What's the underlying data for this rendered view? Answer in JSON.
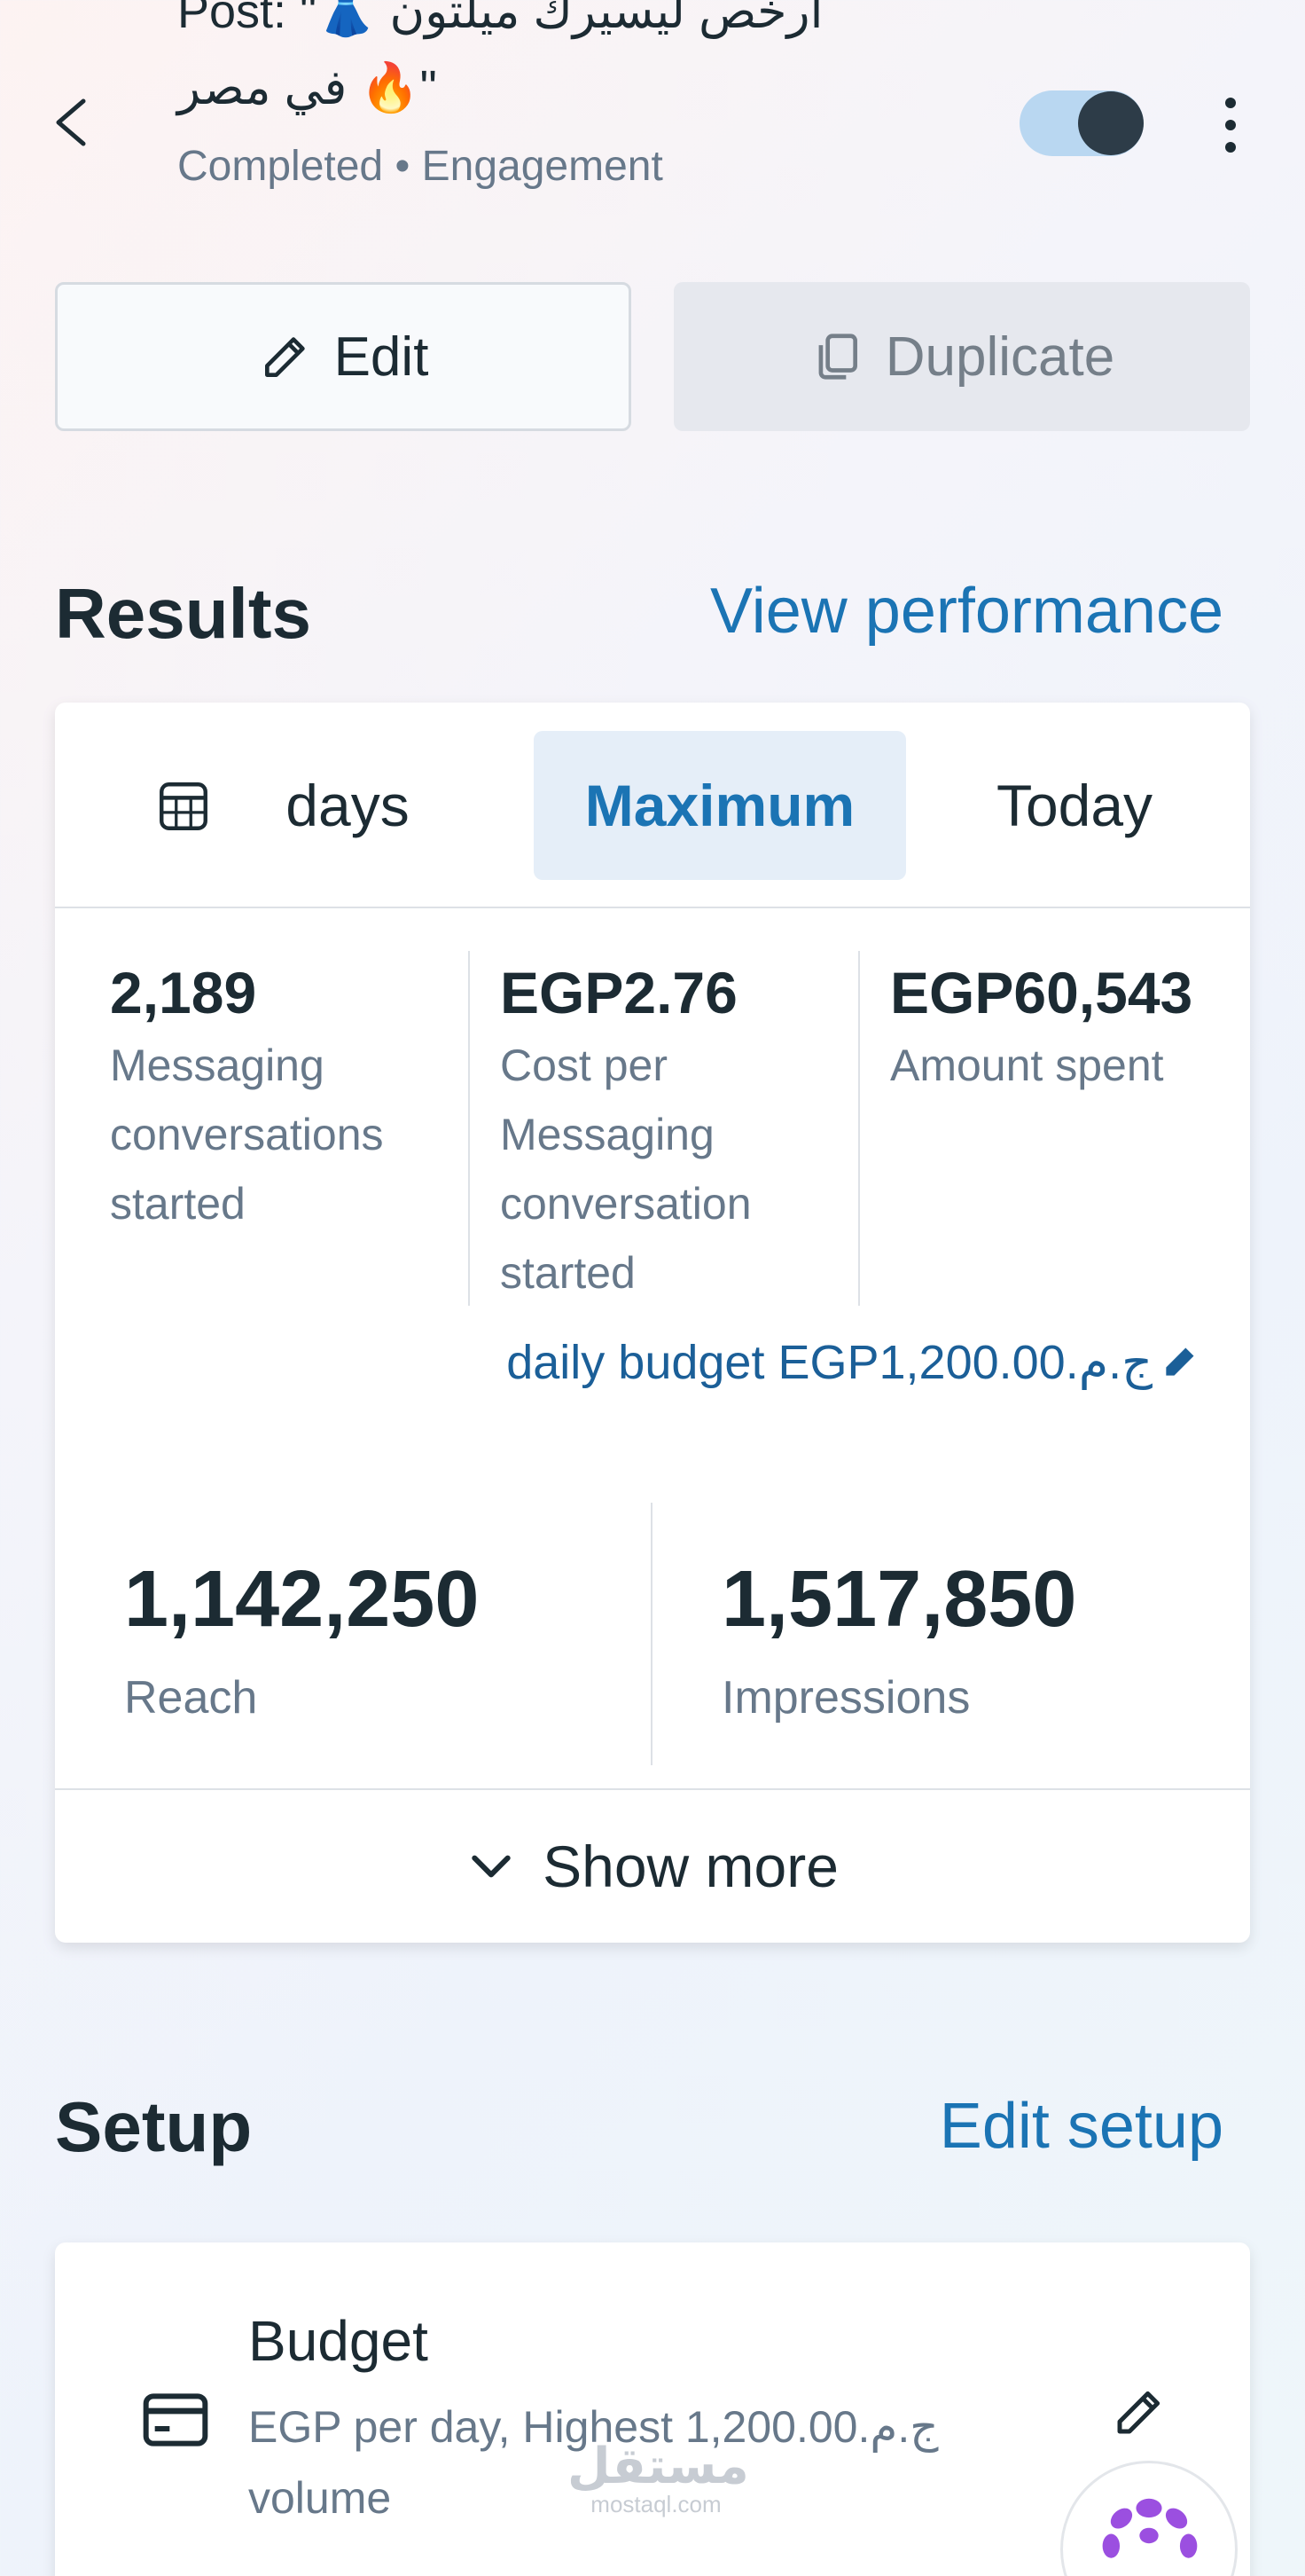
{
  "header": {
    "title_line1": "Post: \"👗 ارخص ليسيرك ميلتون",
    "title_line2": "في مصر 🔥\"",
    "status": "Completed",
    "separator": "•",
    "objective": "Engagement",
    "toggle_on": true
  },
  "actions": {
    "edit_label": "Edit",
    "duplicate_label": "Duplicate"
  },
  "results": {
    "heading": "Results",
    "link": "View performance",
    "tabs": [
      {
        "label": "days"
      },
      {
        "label": "Maximum",
        "selected": true
      },
      {
        "label": "Today"
      }
    ],
    "metrics": [
      {
        "value": "2,189",
        "label": "Messaging conversations started"
      },
      {
        "value": "EGP2.76",
        "label": "Cost per Messaging conversation started"
      },
      {
        "value": "EGP60,543",
        "label": "Amount spent"
      }
    ],
    "daily_budget": "daily budget EGP1,200.00.ج.م",
    "reach": {
      "value": "1,142,250",
      "label": "Reach"
    },
    "impressions": {
      "value": "1,517,850",
      "label": "Impressions"
    },
    "show_more": "Show more"
  },
  "setup": {
    "heading": "Setup",
    "link": "Edit setup",
    "budget_title": "Budget",
    "budget_desc": "EGP per day, Highest 1,200.00.ج.م volume"
  },
  "watermark": {
    "arabic": "مستقل",
    "latin": "mostaql.com"
  },
  "colors": {
    "accent": "#1b74b4",
    "text": "#1c2b33",
    "muted": "#67788a",
    "toggle_track": "#b9d7f1",
    "tab_selected_bg": "#e5eef8"
  }
}
